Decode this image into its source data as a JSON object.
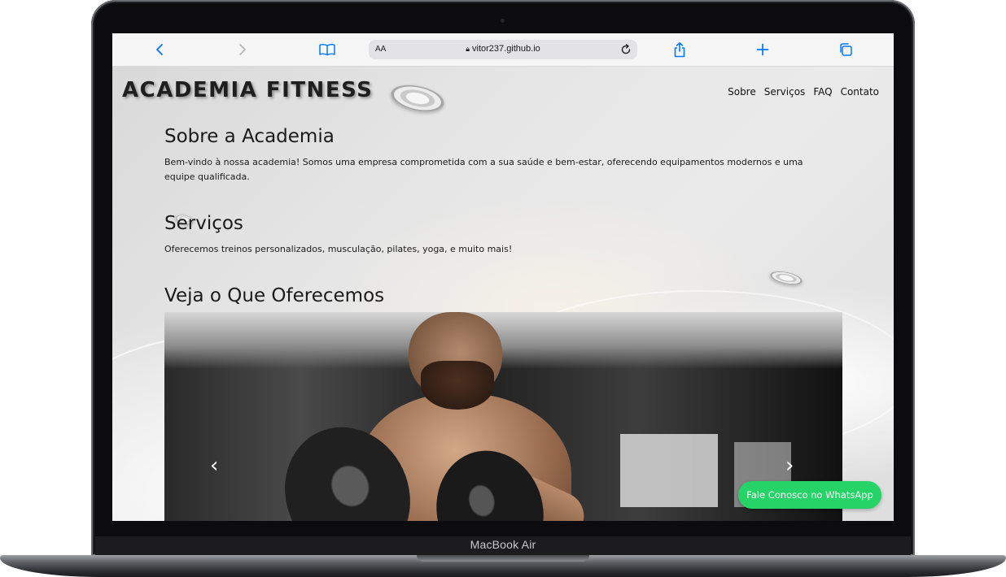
{
  "browser": {
    "text_size_label": "AA",
    "url": "vitor237.github.io"
  },
  "icons": {
    "back": "chevron-left-icon",
    "forward": "chevron-right-icon",
    "bookmarks": "book-icon",
    "lock": "lock-icon",
    "reload": "reload-icon",
    "share": "share-icon",
    "new_tab": "plus-icon",
    "tabs": "tabs-icon"
  },
  "site": {
    "logo": "ACADEMIA FITNESS",
    "nav": [
      "Sobre",
      "Serviços",
      "FAQ",
      "Contato"
    ],
    "sections": {
      "about": {
        "title": "Sobre a Academia",
        "text": "Bem-vindo à nossa academia! Somos uma empresa comprometida com a sua saúde e bem-estar, oferecendo equipamentos modernos e uma equipe qualificada."
      },
      "services": {
        "title": "Serviços",
        "text": "Oferecemos treinos personalizados, musculação, pilates, yoga, e muito mais!"
      },
      "offer": {
        "title": "Veja o Que Oferecemos"
      }
    },
    "carousel": {
      "prev": "‹",
      "next": "›"
    },
    "whatsapp_button": "Fale Conosco no WhatsApp"
  },
  "device": {
    "model": "MacBook Air"
  },
  "colors": {
    "accent": "#007aff",
    "whatsapp": "#25d366"
  }
}
